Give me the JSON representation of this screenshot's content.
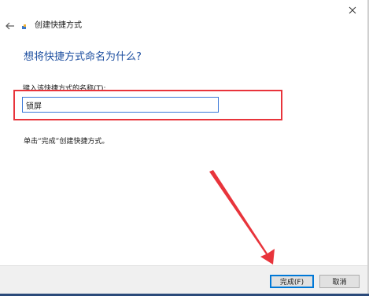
{
  "window": {
    "close_glyph": "✕"
  },
  "wizard": {
    "back_glyph": "←",
    "title": "创建快捷方式",
    "heading": "想将快捷方式命名为什么?",
    "field_label": "键入该快捷方式的名称(T):",
    "name_value": "锁屏",
    "instruction": "单击“完成”创建快捷方式。"
  },
  "footer": {
    "finish_label": "完成(F)",
    "cancel_label": "取消"
  },
  "annotations": {
    "highlight_color": "#e8343b",
    "arrow_color": "#e8343b"
  },
  "colors": {
    "heading": "#1e4fa0",
    "focus_border": "#0078d7"
  }
}
